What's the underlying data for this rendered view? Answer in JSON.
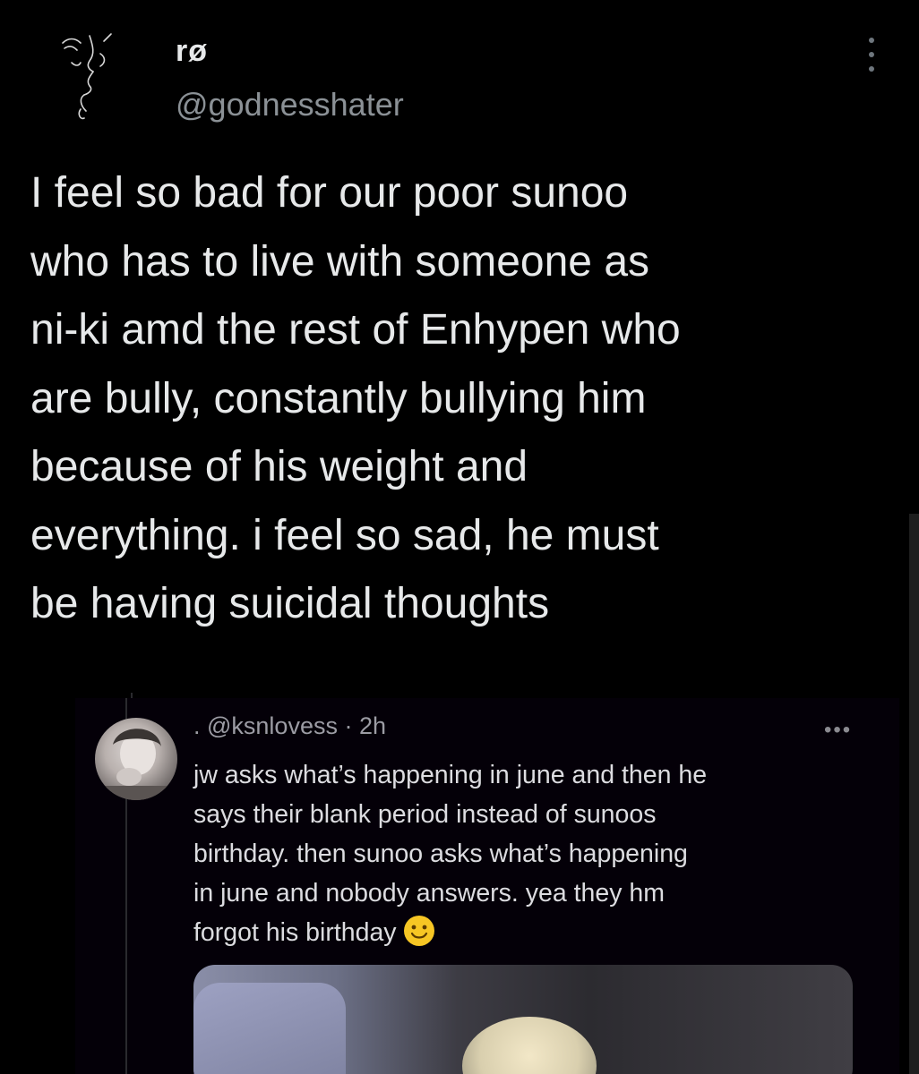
{
  "tweet": {
    "display_name": "rø",
    "handle": "@godnesshater",
    "text": "I feel so bad for our poor sunoo\nwho has to live with someone as\nni-ki amd the rest of Enhypen who\nare bully, constantly bullying him\nbecause of his weight and\neverything. i feel so sad, he must\nbe having suicidal thoughts",
    "avatar_icon": "line-art-face-avatar",
    "more_icon": "vertical-ellipsis-icon"
  },
  "embedded_screenshot": {
    "meta": ". @ksnlovess · 2h",
    "more_label": "•••",
    "text": "jw asks what’s happening in june and then he\nsays their blank period instead of sunoos\nbirthday. then sunoo asks what’s happening\nin june and nobody answers. yea they hm\nforgot his birthday",
    "emoji_icon": "slightly-smiling-face-emoji"
  },
  "colors": {
    "background": "#000000",
    "text_primary": "#e7e9ea",
    "text_secondary": "#8b9196",
    "emoji": "#f7c624"
  }
}
